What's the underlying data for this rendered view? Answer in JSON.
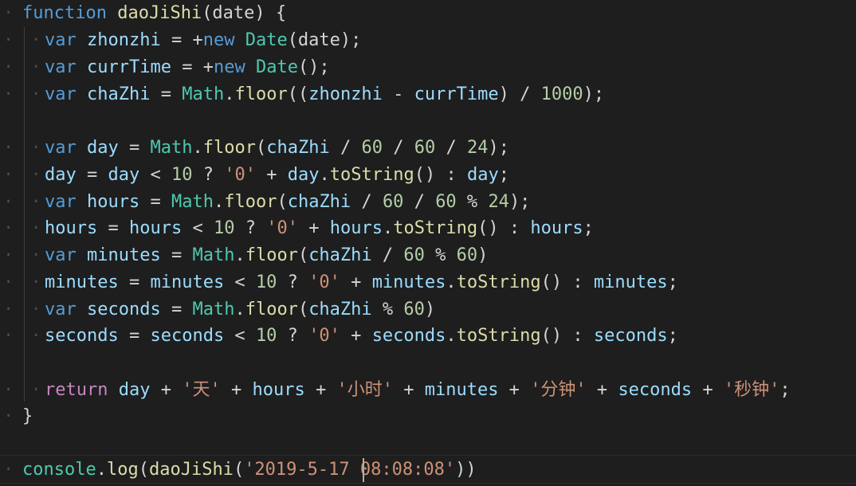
{
  "editor": {
    "whitespace_marker": "· ·",
    "line1": {
      "kw": "function",
      "name": "daoJiShi",
      "rest": "(date) {"
    },
    "line2": {
      "kw": "var",
      "v": "zhonzhi",
      "op": " = +",
      "kw_new": "new",
      "cls": "Date",
      "rest": "(date);"
    },
    "line3": {
      "kw": "var",
      "v": "currTime",
      "op": " = +",
      "kw_new": "new",
      "cls": "Date",
      "rest": "();"
    },
    "line4": {
      "kw": "var",
      "v": "chaZhi",
      "op": " = ",
      "cls": "Math",
      "dot": ".",
      "fn": "floor",
      "p1": "((",
      "a": "zhonzhi",
      "minus": " - ",
      "b": "currTime",
      "p2": ") / ",
      "num": "1000",
      "end": ");"
    },
    "line6": {
      "kw": "var",
      "v": "day",
      "op": " = ",
      "cls": "Math",
      "dot": ".",
      "fn": "floor",
      "p1": "(",
      "a": "chaZhi",
      "div1": " / ",
      "n1": "60",
      "div2": " / ",
      "n2": "60",
      "div3": " / ",
      "n3": "24",
      "end": ");"
    },
    "line7": {
      "v": "day",
      "eq": " = ",
      "v2": "day",
      "lt": " < ",
      "n": "10",
      "q": " ? ",
      "s": "'0'",
      "plus": " + ",
      "v3": "day",
      "dot": ".",
      "fn": "toString",
      "call": "() : ",
      "v4": "day",
      "end": ";"
    },
    "line8": {
      "kw": "var",
      "v": "hours",
      "op": " = ",
      "cls": "Math",
      "dot": ".",
      "fn": "floor",
      "p1": "(",
      "a": "chaZhi",
      "div1": " / ",
      "n1": "60",
      "div2": " / ",
      "n2": "60",
      "mod": " % ",
      "n3": "24",
      "end": ");"
    },
    "line9": {
      "v": "hours",
      "eq": " = ",
      "v2": "hours",
      "lt": " < ",
      "n": "10",
      "q": " ? ",
      "s": "'0'",
      "plus": " + ",
      "v3": "hours",
      "dot": ".",
      "fn": "toString",
      "call": "() : ",
      "v4": "hours",
      "end": ";"
    },
    "line10": {
      "kw": "var",
      "v": "minutes",
      "op": " = ",
      "cls": "Math",
      "dot": ".",
      "fn": "floor",
      "p1": "(",
      "a": "chaZhi",
      "div1": " / ",
      "n1": "60",
      "mod": " % ",
      "n2": "60",
      "end": ")"
    },
    "line11": {
      "v": "minutes",
      "eq": " = ",
      "v2": "minutes",
      "lt": " < ",
      "n": "10",
      "q": " ? ",
      "s": "'0'",
      "plus": " + ",
      "v3": "minutes",
      "dot": ".",
      "fn": "toString",
      "call": "() : ",
      "v4": "minutes",
      "end": ";"
    },
    "line12": {
      "kw": "var",
      "v": "seconds",
      "op": " = ",
      "cls": "Math",
      "dot": ".",
      "fn": "floor",
      "p1": "(",
      "a": "chaZhi",
      "mod": " % ",
      "n1": "60",
      "end": ")"
    },
    "line13": {
      "v": "seconds",
      "eq": " = ",
      "v2": "seconds",
      "lt": " < ",
      "n": "10",
      "q": " ? ",
      "s": "'0'",
      "plus": " + ",
      "v3": "seconds",
      "dot": ".",
      "fn": "toString",
      "call": "() : ",
      "v4": "seconds",
      "end": ";"
    },
    "line15": {
      "kw": "return",
      "v1": "day",
      "p1": " + ",
      "s1": "'天'",
      "p2": " + ",
      "v2": "hours",
      "p3": " + ",
      "s2": "'小时'",
      "p4": " + ",
      "v3": "minutes",
      "p5": " + ",
      "s3": "'分钟'",
      "p6": " + ",
      "v4": "seconds",
      "p7": " + ",
      "s4": "'秒钟'",
      "end": ";"
    },
    "line16": {
      "brace": "}"
    },
    "line18": {
      "obj": "console",
      "dot": ".",
      "fn": "log",
      "p1": "(",
      "fn2": "daoJiShi",
      "p2": "(",
      "s": "'2019-5-17 08:08:08'",
      "end": "))"
    }
  },
  "colors": {
    "background": "#1e1e1e",
    "keyword": "#569cd6",
    "control_keyword": "#c586c0",
    "function": "#dcdcaa",
    "variable": "#9cdcfe",
    "class": "#4ec9b0",
    "number": "#b5cea8",
    "string": "#ce9178"
  }
}
